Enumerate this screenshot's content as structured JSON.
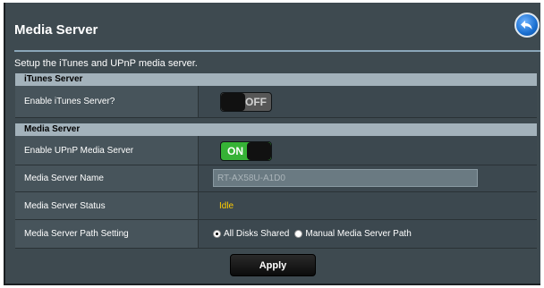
{
  "page": {
    "title": "Media Server",
    "description": "Setup the iTunes and UPnP media server."
  },
  "itunes_section": {
    "header": "iTunes Server",
    "enable_label": "Enable iTunes Server?",
    "toggle": {
      "state": "off",
      "label": "OFF"
    }
  },
  "media_section": {
    "header": "Media Server",
    "enable_label": "Enable UPnP Media Server",
    "toggle": {
      "state": "on",
      "label": "ON"
    },
    "name_label": "Media Server Name",
    "name_value": "RT-AX58U-A1D0",
    "status_label": "Media Server Status",
    "status_value": "Idle",
    "path_label": "Media Server Path Setting",
    "path_options": [
      {
        "label": "All Disks Shared",
        "selected": true
      },
      {
        "label": "Manual Media Server Path",
        "selected": false
      }
    ]
  },
  "apply_label": "Apply",
  "colors": {
    "background": "#3e4a50",
    "section_header": "#a3b2bb",
    "toggle_on": "#36b236",
    "status": "#ffcc00"
  },
  "icons": {
    "back": "back-arrow-icon"
  }
}
